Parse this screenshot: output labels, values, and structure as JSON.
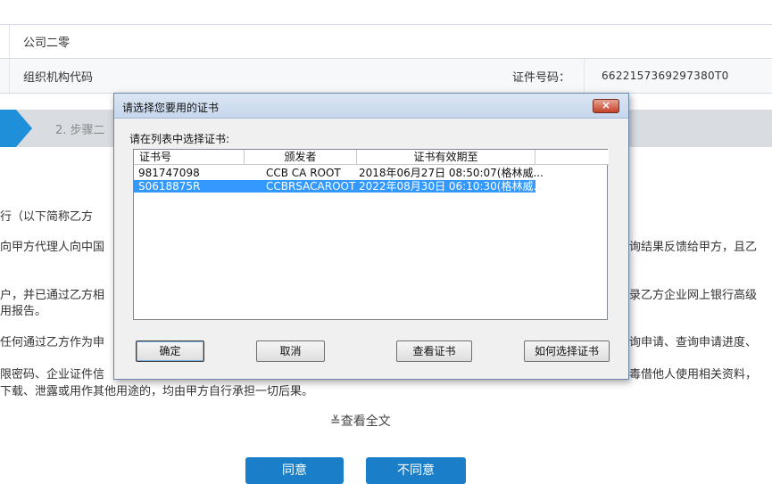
{
  "page": {
    "company_name": "公司二零",
    "org_code_label": "组织机构代码",
    "cert_no_label": "证件号码：",
    "cert_no_value": "66221573692973​80T0",
    "step2_label": "2. 步骤二",
    "paragraphs": {
      "p1": "行（以下简称乙方",
      "p2": "向甲方代理人向中国",
      "p2r": "询结果反馈给甲方，且乙",
      "p3": "户，并已通过乙方相",
      "p3b": "用报告。",
      "p3r": "录乙方企业网上银行高级",
      "p4": "任何通过乙方作为申",
      "p4r": "询申请、查询申请进度、",
      "p5": "限密码、企业证件信",
      "p5r": "毒借他人使用相关资料，",
      "p5b": "下载、泄露或用作其他用途的，均由甲方自行承担一切后果。"
    },
    "expand_link": "≚查看全文",
    "buttons": {
      "agree": "同意",
      "disagree": "不同意"
    }
  },
  "dialog": {
    "title": "请选择您要用的证书",
    "close_glyph": "×",
    "prompt": "请在列表中选择证书:",
    "columns": [
      "证书号",
      "颁发者",
      "证书有效期至",
      ""
    ],
    "rows": [
      {
        "cert_no": "981747098",
        "issuer": "CCB CA ROOT",
        "expiry": "2018年06月27日 08:50:07(格林威...",
        "selected": false
      },
      {
        "cert_no": "S0618875R",
        "issuer": "CCBRSACAROOT",
        "expiry": "2022年08月30日 06:10:30(格林威...",
        "selected": true
      }
    ],
    "buttons": {
      "ok": "确定",
      "cancel": "取消",
      "view": "查看证书",
      "how": "如何选择证书"
    }
  },
  "colors": {
    "step_active": "#1f8fd9",
    "selection": "#3399ff",
    "primary_button": "#1a7fc8"
  }
}
